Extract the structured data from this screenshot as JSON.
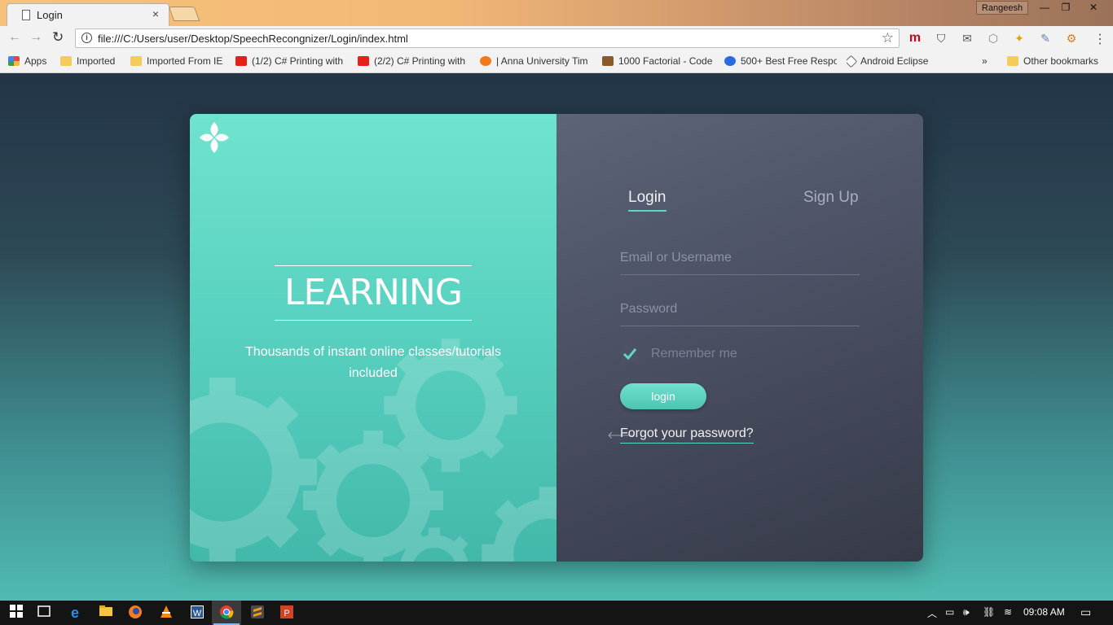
{
  "browser": {
    "tab_title": "Login",
    "tab_close": "×",
    "profile_name": "Rangeesh",
    "window_buttons": {
      "minimize": "—",
      "maximize": "❐",
      "close": "✕"
    },
    "url": "file:///C:/Users/user/Desktop/SpeechRecongnizer/Login/index.html",
    "info_glyph": "i",
    "star_glyph": "☆",
    "menu_glyph": "⋮",
    "nav": {
      "back": "←",
      "forward": "→",
      "reload": "↻"
    },
    "extensions": [
      "m",
      "⛉",
      "✉",
      "⬡",
      "✦",
      "✎",
      "⚙"
    ],
    "bookmarks": [
      {
        "label": "Apps",
        "icon": "apps-grid-icon",
        "color": "#e8453c"
      },
      {
        "label": "Imported",
        "icon": "folder-icon",
        "color": "#f5cb5c"
      },
      {
        "label": "Imported From IE",
        "icon": "folder-icon",
        "color": "#f5cb5c"
      },
      {
        "label": "(1/2) C# Printing with",
        "icon": "youtube-icon",
        "color": "#e62117"
      },
      {
        "label": "(2/2) C# Printing with",
        "icon": "youtube-icon",
        "color": "#e62117"
      },
      {
        "label": "| Anna University Tim",
        "icon": "flame-icon",
        "color": "#f07a1a"
      },
      {
        "label": "1000 Factorial - Code",
        "icon": "chef-icon",
        "color": "#8a5a2a"
      },
      {
        "label": "500+ Best Free Respo",
        "icon": "c-badge-icon",
        "color": "#2a6be3"
      },
      {
        "label": "Android Eclipse",
        "icon": "diamond-icon",
        "color": "#666666"
      }
    ],
    "bookmarks_overflow": "»",
    "other_bookmarks": "Other bookmarks"
  },
  "left_panel": {
    "title": "LEARNING",
    "subtitle": "Thousands of instant online classes/tutorials included"
  },
  "login_form": {
    "tabs": {
      "login": "Login",
      "signup": "Sign Up"
    },
    "email_placeholder": "Email or Username",
    "password_placeholder": "Password",
    "remember_label": "Remember me",
    "remember_checked": true,
    "submit_label": "login",
    "forgot_label": "Forgot your password?",
    "forgot_arrow": "🡐",
    "accent_color": "#5fd6c3"
  },
  "taskbar": {
    "clock": "09:08 AM",
    "tray_glyphs": {
      "up": "︿",
      "battery": "▭",
      "volume": "🕪",
      "network": "≋",
      "notify": "▭"
    },
    "apps": [
      "windows-start-icon",
      "task-view-icon",
      "edge-icon",
      "file-explorer-icon",
      "firefox-icon",
      "vlc-icon",
      "word-icon",
      "chrome-icon",
      "sublime-icon",
      "powerpoint-icon"
    ]
  }
}
